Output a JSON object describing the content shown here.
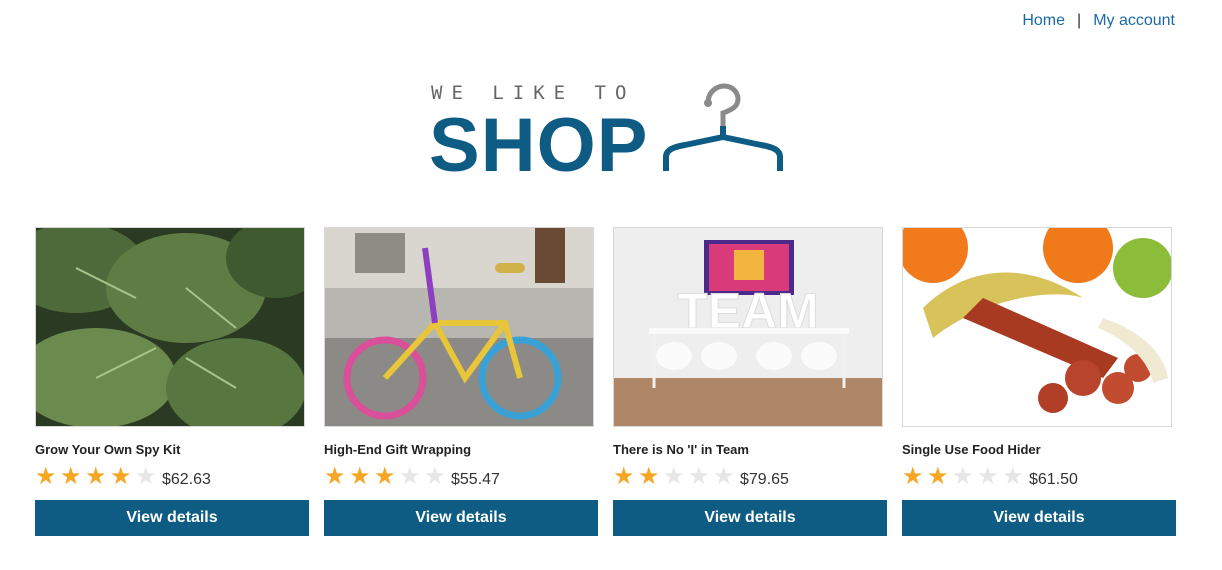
{
  "nav": {
    "home": "Home",
    "separator": "|",
    "account": "My account"
  },
  "logo": {
    "tagline": "WE LIKE TO",
    "main": "SHOP",
    "icon": "hanger-icon"
  },
  "colors": {
    "brand": "#0e5c83",
    "link": "#1a6aa5",
    "star_on": "#f5a623",
    "star_off": "#e6e6e6"
  },
  "products": [
    {
      "name": "Grow Your Own Spy Kit",
      "rating": 4,
      "max_rating": 5,
      "price": "$62.63",
      "button": "View details"
    },
    {
      "name": "High-End Gift Wrapping",
      "rating": 3,
      "max_rating": 5,
      "price": "$55.47",
      "button": "View details"
    },
    {
      "name": "There is No 'I' in Team",
      "rating": 2,
      "max_rating": 5,
      "price": "$79.65",
      "button": "View details",
      "image_text": "TEAM"
    },
    {
      "name": "Single Use Food Hider",
      "rating": 2,
      "max_rating": 5,
      "price": "$61.50",
      "button": "View details"
    }
  ]
}
